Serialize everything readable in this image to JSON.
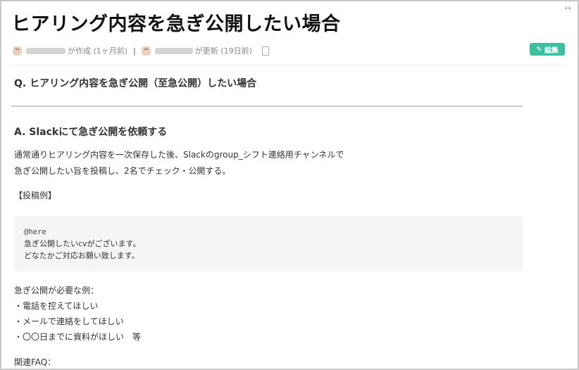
{
  "page": {
    "title": "ヒアリング内容を急ぎ公開したい場合",
    "expand_icon": "↔"
  },
  "meta": {
    "created_text": "が作成 (1ヶ月前)",
    "separator": "|",
    "updated_text": "が更新 (19日前)",
    "icons": [
      "avatar-icon",
      "clipboard-icon"
    ]
  },
  "edit_button": {
    "icon": "pencil-icon",
    "label": "編集"
  },
  "content": {
    "question": "Q. ヒアリング内容を急ぎ公開（至急公開）したい場合",
    "answer_heading": "A. Slackにて急ぎ公開を依頼する",
    "intro_lines": [
      "通常通りヒアリング内容を一次保存した後、Slackのgroup_シフト連絡用チャンネルで",
      "急ぎ公開したい旨を投稿し、2名でチェック・公開する。"
    ],
    "example_label": "【投稿例】",
    "code_lines": [
      "@here",
      "急ぎ公開したいcvがございます。",
      "どなたかご対応お願い致します。"
    ],
    "needed_heading": "急ぎ公開が必要な例：",
    "needed_items": [
      "・電話を控えてほしい",
      "・メールで連絡をしてほしい",
      "・〇〇日までに資料がほしい　等"
    ],
    "faq_label": "関連FAQ："
  },
  "colors": {
    "accent": "#3dbfa0",
    "divider": "#cccccc",
    "code_bg": "#f5f5f5"
  }
}
